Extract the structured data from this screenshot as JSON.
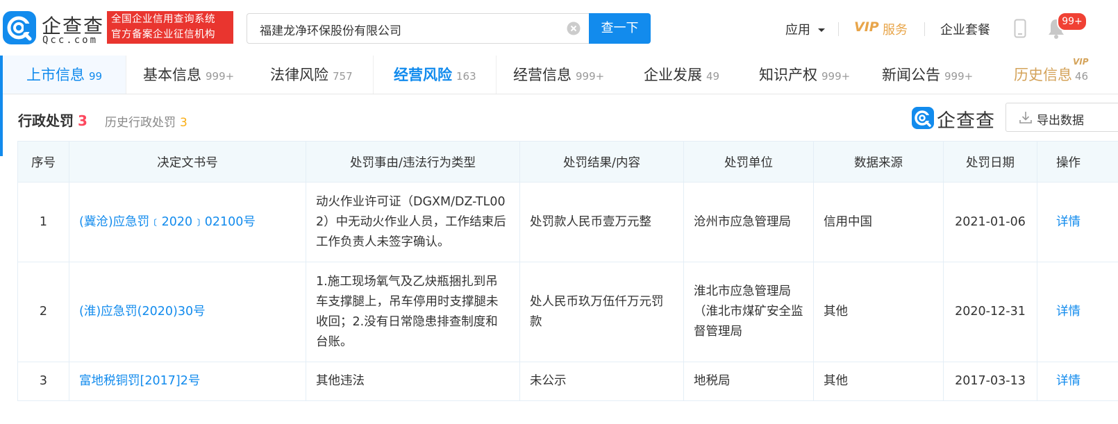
{
  "header": {
    "logo_name": "企查查",
    "logo_sub": "Qcc.com",
    "slogan_line1": "全国企业信用查询系统",
    "slogan_line2": "官方备案企业征信机构",
    "search_value": "福建龙净环保股份有限公司",
    "search_button": "查一下",
    "nav_apps": "应用",
    "nav_vip": "VIP",
    "nav_vip_service": "服务",
    "nav_package": "企业套餐",
    "badge": "99+"
  },
  "tabs": [
    {
      "label": "上市信息",
      "count": "99"
    },
    {
      "label": "基本信息",
      "count": "999+"
    },
    {
      "label": "法律风险",
      "count": "757"
    },
    {
      "label": "经营风险",
      "count": "163"
    },
    {
      "label": "经营信息",
      "count": "999+"
    },
    {
      "label": "企业发展",
      "count": "49"
    },
    {
      "label": "知识产权",
      "count": "999+"
    },
    {
      "label": "新闻公告",
      "count": "999+"
    },
    {
      "label": "历史信息",
      "count": "46"
    }
  ],
  "tab_vip_tag": "VIP",
  "section": {
    "title": "行政处罚",
    "count": "3",
    "history_label": "历史行政处罚",
    "history_count": "3",
    "brand": "企查查",
    "export_label": "导出数据"
  },
  "table": {
    "headers": [
      "序号",
      "决定文书号",
      "处罚事由/违法行为类型",
      "处罚结果/内容",
      "处罚单位",
      "数据来源",
      "处罚日期",
      "操作"
    ],
    "rows": [
      {
        "no": "1",
        "doc": "(冀沧)应急罚﹝2020﹞02100号",
        "reason": "动火作业许可证（DGXM/DZ-TL002）中无动火作业人员，工作结束后工作负责人未签字确认。",
        "result": "处罚款人民币壹万元整",
        "unit": "沧州市应急管理局",
        "source": "信用中国",
        "date": "2021-01-06",
        "action": "详情"
      },
      {
        "no": "2",
        "doc": "(淮)应急罚(2020)30号",
        "reason": "1.施工现场氧气及乙炔瓶捆扎到吊车支撑腿上，吊车停用时支撑腿未收回；2.没有日常隐患排查制度和台账。",
        "result": "处人民币玖万伍仟万元罚款",
        "unit": "淮北市应急管理局（淮北市煤矿安全监督管理局",
        "source": "其他",
        "date": "2020-12-31",
        "action": "详情"
      },
      {
        "no": "3",
        "doc": "富地税铜罚[2017]2号",
        "reason": "其他违法",
        "result": "未公示",
        "unit": "地税局",
        "source": "其他",
        "date": "2017-03-13",
        "action": "详情"
      }
    ]
  }
}
